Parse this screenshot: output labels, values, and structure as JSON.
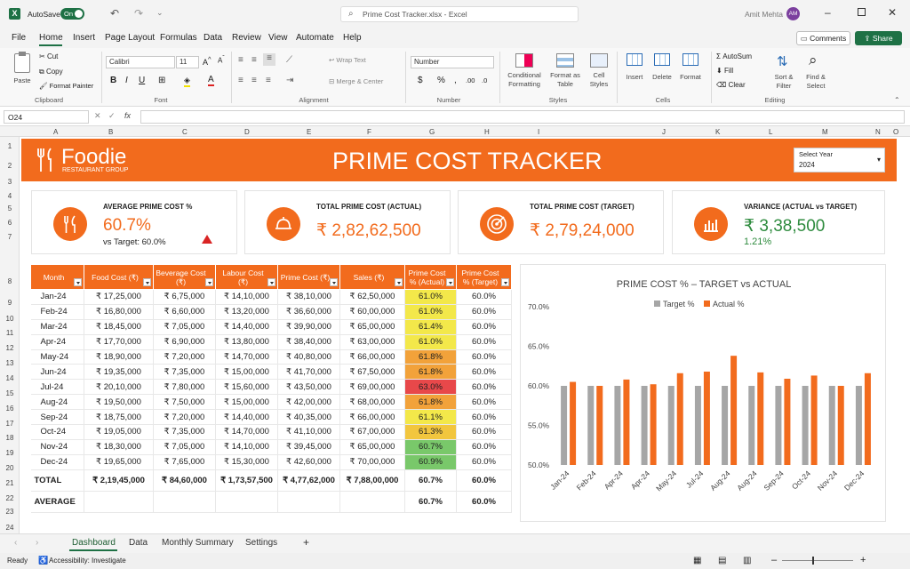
{
  "titlebar": {
    "autosave_label": "AutoSave",
    "autosave_state": "On",
    "search_text": "Prime Cost Tracker.xlsx - Excel",
    "user_name": "Amit Mehta",
    "user_initials": "AM"
  },
  "menu": {
    "items": [
      "File",
      "Home",
      "Insert",
      "Page Layout",
      "Formulas",
      "Data",
      "Review",
      "View",
      "Automate",
      "Help"
    ],
    "active": "Home",
    "comments_label": "Comments",
    "share_label": "Share"
  },
  "ribbon": {
    "clipboard": {
      "paste": "Paste",
      "cut": "Cut",
      "copy": "Copy",
      "format_painter": "Format Painter",
      "group": "Clipboard"
    },
    "font": {
      "name": "Calibri",
      "size": "11",
      "group": "Font"
    },
    "alignment": {
      "wrap": "Wrap Text",
      "merge": "Merge & Center",
      "group": "Alignment"
    },
    "number": {
      "format": "Number",
      "group": "Number"
    },
    "styles": {
      "conditional": "Conditional Formatting",
      "format_table": "Format as Table",
      "cell_styles": "Cell Styles",
      "group": "Styles"
    },
    "cells": {
      "insert": "Insert",
      "delete": "Delete",
      "format": "Format",
      "group": "Cells"
    },
    "editing": {
      "autosum": "AutoSum",
      "fill": "Fill",
      "clear": "Clear",
      "sort": "Sort & Filter",
      "find": "Find & Select",
      "group": "Editing"
    }
  },
  "formula_bar": {
    "cell_ref": "O24",
    "fx": "fx",
    "content": ""
  },
  "grid": {
    "col_headers": [
      "A",
      "B",
      "C",
      "D",
      "E",
      "F",
      "G",
      "H",
      "I",
      "J",
      "K",
      "L",
      "M",
      "N",
      "O"
    ],
    "row_headers": [
      "1",
      "2",
      "3",
      "4",
      "5",
      "6",
      "7",
      "8",
      "9",
      "10",
      "11",
      "12",
      "13",
      "14",
      "15",
      "16",
      "17",
      "18",
      "19",
      "20",
      "21",
      "22",
      "23",
      "24",
      "25",
      "26"
    ]
  },
  "dashboard": {
    "brand": "Foodie",
    "brand_sub": "RESTAURANT GROUP",
    "title": "PRIME COST TRACKER",
    "year_label": "Select Year",
    "year_value": "2024",
    "accent": "#f26b1d",
    "kpis": [
      {
        "label": "AVERAGE PRIME COST %",
        "value": "60.7%",
        "sub": "vs Target: 60.0%",
        "icon": "cutlery-icon"
      },
      {
        "label": "TOTAL PRIME COST (ACTUAL)",
        "value": "₹ 2,82,62,500",
        "sub": "",
        "icon": "cloche-icon"
      },
      {
        "label": "TOTAL PRIME COST (TARGET)",
        "value": "₹ 2,79,24,000",
        "sub": "",
        "icon": "target-icon"
      },
      {
        "label": "VARIANCE (ACTUAL vs TARGET)",
        "value": "₹ 3,38,500",
        "sub": "1.21%",
        "icon": "bar-chart-icon"
      }
    ]
  },
  "table": {
    "headers": [
      "Month",
      "Food Cost (₹)",
      "Beverage Cost (₹)",
      "Labour Cost (₹)",
      "Prime Cost (₹)",
      "Sales (₹)",
      "Prime Cost % (Actual)",
      "Prime Cost % (Target)"
    ],
    "rows": [
      [
        "Jan-24",
        "₹ 17,25,000",
        "₹ 6,75,000",
        "₹ 14,10,000",
        "₹ 38,10,000",
        "₹ 62,50,000",
        "61.0%",
        "60.0%"
      ],
      [
        "Feb-24",
        "₹ 16,80,000",
        "₹ 6,60,000",
        "₹ 13,20,000",
        "₹ 36,60,000",
        "₹ 60,00,000",
        "61.0%",
        "60.0%"
      ],
      [
        "Mar-24",
        "₹ 18,45,000",
        "₹ 7,05,000",
        "₹ 14,40,000",
        "₹ 39,90,000",
        "₹ 65,00,000",
        "61.4%",
        "60.0%"
      ],
      [
        "Apr-24",
        "₹ 17,70,000",
        "₹ 6,90,000",
        "₹ 13,80,000",
        "₹ 38,40,000",
        "₹ 63,00,000",
        "61.0%",
        "60.0%"
      ],
      [
        "May-24",
        "₹ 18,90,000",
        "₹ 7,20,000",
        "₹ 14,70,000",
        "₹ 40,80,000",
        "₹ 66,00,000",
        "61.8%",
        "60.0%"
      ],
      [
        "Jun-24",
        "₹ 19,35,000",
        "₹ 7,35,000",
        "₹ 15,00,000",
        "₹ 41,70,000",
        "₹ 67,50,000",
        "61.8%",
        "60.0%"
      ],
      [
        "Jul-24",
        "₹ 20,10,000",
        "₹ 7,80,000",
        "₹ 15,60,000",
        "₹ 43,50,000",
        "₹ 69,00,000",
        "63.0%",
        "60.0%"
      ],
      [
        "Aug-24",
        "₹ 19,50,000",
        "₹ 7,50,000",
        "₹ 15,00,000",
        "₹ 42,00,000",
        "₹ 68,00,000",
        "61.8%",
        "60.0%"
      ],
      [
        "Sep-24",
        "₹ 18,75,000",
        "₹ 7,20,000",
        "₹ 14,40,000",
        "₹ 40,35,000",
        "₹ 66,00,000",
        "61.1%",
        "60.0%"
      ],
      [
        "Oct-24",
        "₹ 19,05,000",
        "₹ 7,35,000",
        "₹ 14,70,000",
        "₹ 41,10,000",
        "₹ 67,00,000",
        "61.3%",
        "60.0%"
      ],
      [
        "Nov-24",
        "₹ 18,30,000",
        "₹ 7,05,000",
        "₹ 14,10,000",
        "₹ 39,45,000",
        "₹ 65,00,000",
        "60.7%",
        "60.0%"
      ],
      [
        "Dec-24",
        "₹ 19,65,000",
        "₹ 7,65,000",
        "₹ 15,30,000",
        "₹ 42,60,000",
        "₹ 70,00,000",
        "60.9%",
        "60.0%"
      ]
    ],
    "heat_colors": [
      "#f3e84a",
      "#f3e84a",
      "#f3e84a",
      "#f3e84a",
      "#f2a23a",
      "#f2a23a",
      "#e8484a",
      "#f2a23a",
      "#f3e84a",
      "#f2c63e",
      "#79c86a",
      "#79c86a"
    ],
    "total": [
      "TOTAL",
      "₹ 2,19,45,000",
      "₹ 84,60,000",
      "₹ 1,73,57,500",
      "₹ 4,77,62,000",
      "₹ 7,88,00,000",
      "60.7%",
      "60.0%"
    ],
    "average": [
      "AVERAGE",
      "",
      "",
      "",
      "",
      "",
      "60.7%",
      "60.0%"
    ]
  },
  "chart_data": {
    "type": "bar",
    "title": "PRIME COST % – TARGET vs ACTUAL",
    "categories": [
      "Jan-24",
      "Feb-24",
      "Apr-24",
      "Apr-24",
      "May-24",
      "Jul-24",
      "Aug-24",
      "Aug-24",
      "Sep-24",
      "Oct-24",
      "Nov-24",
      "Dec-24"
    ],
    "series": [
      {
        "name": "Target %",
        "color": "#a6a6a6",
        "values": [
          60.0,
          60.0,
          60.0,
          60.0,
          60.0,
          60.0,
          60.0,
          60.0,
          60.0,
          60.0,
          60.0,
          60.0
        ]
      },
      {
        "name": "Actual %",
        "color": "#f26b1d",
        "values": [
          60.5,
          60.0,
          60.8,
          60.2,
          61.6,
          61.8,
          63.8,
          61.7,
          60.9,
          61.3,
          60.0,
          61.6
        ]
      }
    ],
    "ylim": [
      50,
      70
    ],
    "yticks": [
      "50.0%",
      "55.0%",
      "60.0%",
      "65.0%",
      "70.0%"
    ],
    "ytick_values": [
      50,
      55,
      60,
      65,
      70
    ],
    "legend": "top-center",
    "grid": false
  },
  "sheet_tabs": {
    "items": [
      "Dashboard",
      "Data",
      "Monthly Summary",
      "Settings"
    ],
    "active": "Dashboard",
    "add": "+"
  },
  "status": {
    "ready": "Ready",
    "accessibility": "Accessibility: Investigate"
  }
}
